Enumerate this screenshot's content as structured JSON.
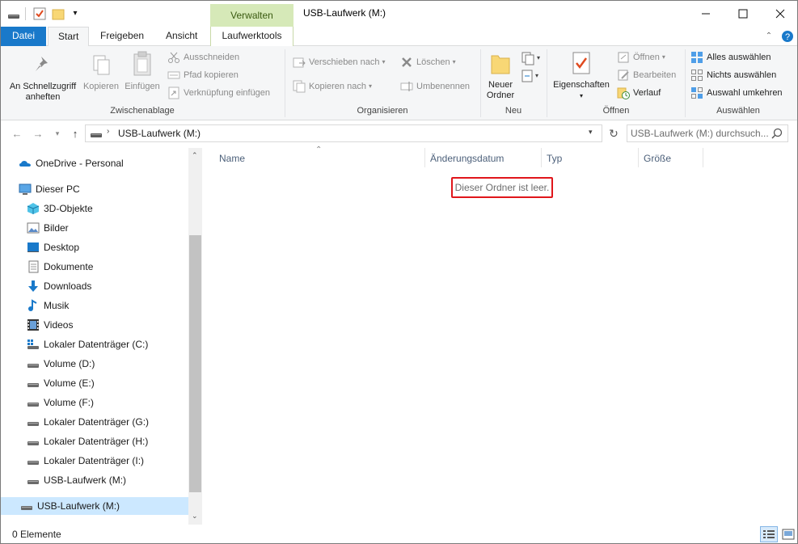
{
  "window": {
    "title": "USB-Laufwerk (M:)",
    "context_header": "Verwalten",
    "controls": [
      "minimize",
      "maximize",
      "close"
    ]
  },
  "tabs": {
    "file": "Datei",
    "start": "Start",
    "share": "Freigeben",
    "view": "Ansicht",
    "drive_tools": "Laufwerktools"
  },
  "ribbon": {
    "clipboard": {
      "label": "Zwischenablage",
      "pin": "An Schnellzugriff anheften",
      "pin_line1": "An Schnellzugriff",
      "pin_line2": "anheften",
      "copy": "Kopieren",
      "paste": "Einfügen",
      "cut": "Ausschneiden",
      "copy_path": "Pfad kopieren",
      "paste_shortcut": "Verknüpfung einfügen"
    },
    "organize": {
      "label": "Organisieren",
      "move_to": "Verschieben nach",
      "copy_to": "Kopieren nach",
      "delete": "Löschen",
      "rename": "Umbenennen"
    },
    "new": {
      "label": "Neu",
      "new_folder_line1": "Neuer",
      "new_folder_line2": "Ordner"
    },
    "open": {
      "label": "Öffnen",
      "properties": "Eigenschaften",
      "open": "Öffnen",
      "edit": "Bearbeiten",
      "history": "Verlauf"
    },
    "select": {
      "label": "Auswählen",
      "select_all": "Alles auswählen",
      "select_none": "Nichts auswählen",
      "invert": "Auswahl umkehren"
    }
  },
  "address": {
    "path": "USB-Laufwerk (M:)",
    "search_placeholder": "USB-Laufwerk (M:) durchsuch..."
  },
  "navigation": {
    "onedrive": "OneDrive - Personal",
    "this_pc": "Dieser PC",
    "items": [
      {
        "label": "3D-Objekte",
        "icon": "3d-objects-icon"
      },
      {
        "label": "Bilder",
        "icon": "pictures-icon"
      },
      {
        "label": "Desktop",
        "icon": "desktop-icon"
      },
      {
        "label": "Dokumente",
        "icon": "documents-icon"
      },
      {
        "label": "Downloads",
        "icon": "downloads-icon"
      },
      {
        "label": "Musik",
        "icon": "music-icon"
      },
      {
        "label": "Videos",
        "icon": "videos-icon"
      },
      {
        "label": "Lokaler Datenträger (C:)",
        "icon": "system-drive-icon"
      },
      {
        "label": "Volume (D:)",
        "icon": "drive-icon"
      },
      {
        "label": "Volume (E:)",
        "icon": "drive-icon"
      },
      {
        "label": "Volume (F:)",
        "icon": "drive-icon"
      },
      {
        "label": "Lokaler Datenträger (G:)",
        "icon": "drive-icon"
      },
      {
        "label": "Lokaler Datenträger (H:)",
        "icon": "drive-icon"
      },
      {
        "label": "Lokaler Datenträger (I:)",
        "icon": "drive-icon"
      },
      {
        "label": "USB-Laufwerk (M:)",
        "icon": "usb-drive-icon"
      }
    ],
    "selected": "USB-Laufwerk (M:)"
  },
  "columns": [
    "Name",
    "Änderungsdatum",
    "Typ",
    "Größe"
  ],
  "empty_message": "Dieser Ordner ist leer.",
  "status": {
    "count": "0 Elemente"
  },
  "colors": {
    "file_tab": "#1979ca",
    "context_header": "#d6e9b8",
    "selection": "#cce8ff",
    "highlight_box": "#e0161b"
  }
}
